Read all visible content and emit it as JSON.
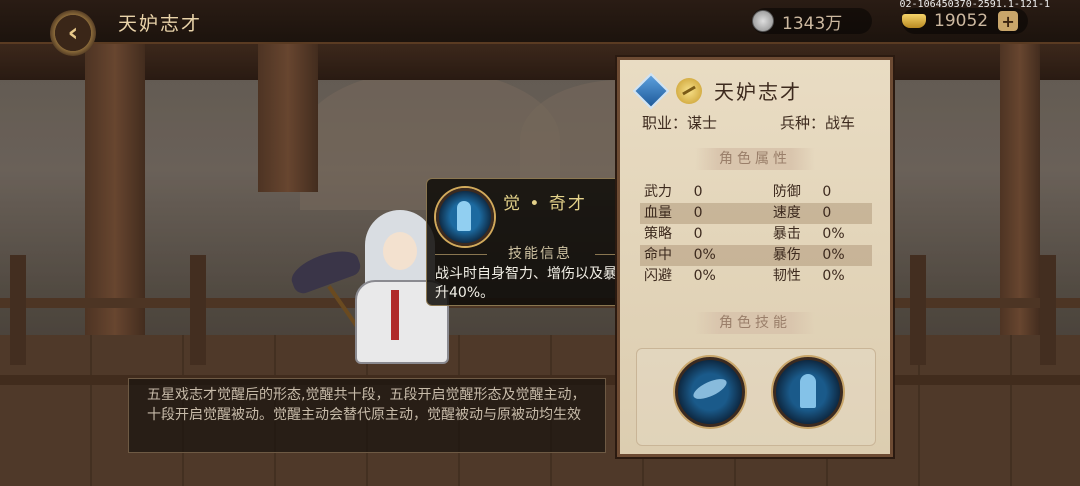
{
  "header": {
    "title": "天妒志才",
    "back_icon": "back-arrow-icon",
    "silver": "1343万",
    "gold": "19052",
    "plus_label": "+",
    "version": "02-106450370-2591.1-121-1"
  },
  "panel": {
    "hero_name": "天妒志才",
    "job_label": "职业：谋士",
    "troop_label": "兵种：战车",
    "attr_heading": "角色属性",
    "skill_heading": "角色技能",
    "stats": [
      {
        "l1": "武力",
        "v1": "0",
        "l2": "防御",
        "v2": "0"
      },
      {
        "l1": "血量",
        "v1": "0",
        "l2": "速度",
        "v2": "0"
      },
      {
        "l1": "策略",
        "v1": "0",
        "l2": "暴击",
        "v2": "0%"
      },
      {
        "l1": "命中",
        "v1": "0%",
        "l2": "暴伤",
        "v2": "0%"
      },
      {
        "l1": "闪避",
        "v1": "0%",
        "l2": "韧性",
        "v2": "0%"
      }
    ],
    "skills": [
      "feather-fan-skill-icon",
      "awakened-strategist-skill-icon"
    ]
  },
  "tooltip": {
    "name": "觉 • 奇才",
    "sub_heading": "技能信息",
    "description": "战斗时自身智力、增伤以及暴击提升40%。"
  },
  "description": "五星戏志才觉醒后的形态,觉醒共十段，五段开启觉醒形态及觉醒主动，十段开启觉醒被动。觉醒主动会替代原主动，觉醒被动与原被动均生效",
  "colors": {
    "panel_bg": "#e6d8bd",
    "panel_border": "#6d4b33",
    "tooltip_title": "#e4d28a",
    "top_bar": "#2a1c14"
  }
}
